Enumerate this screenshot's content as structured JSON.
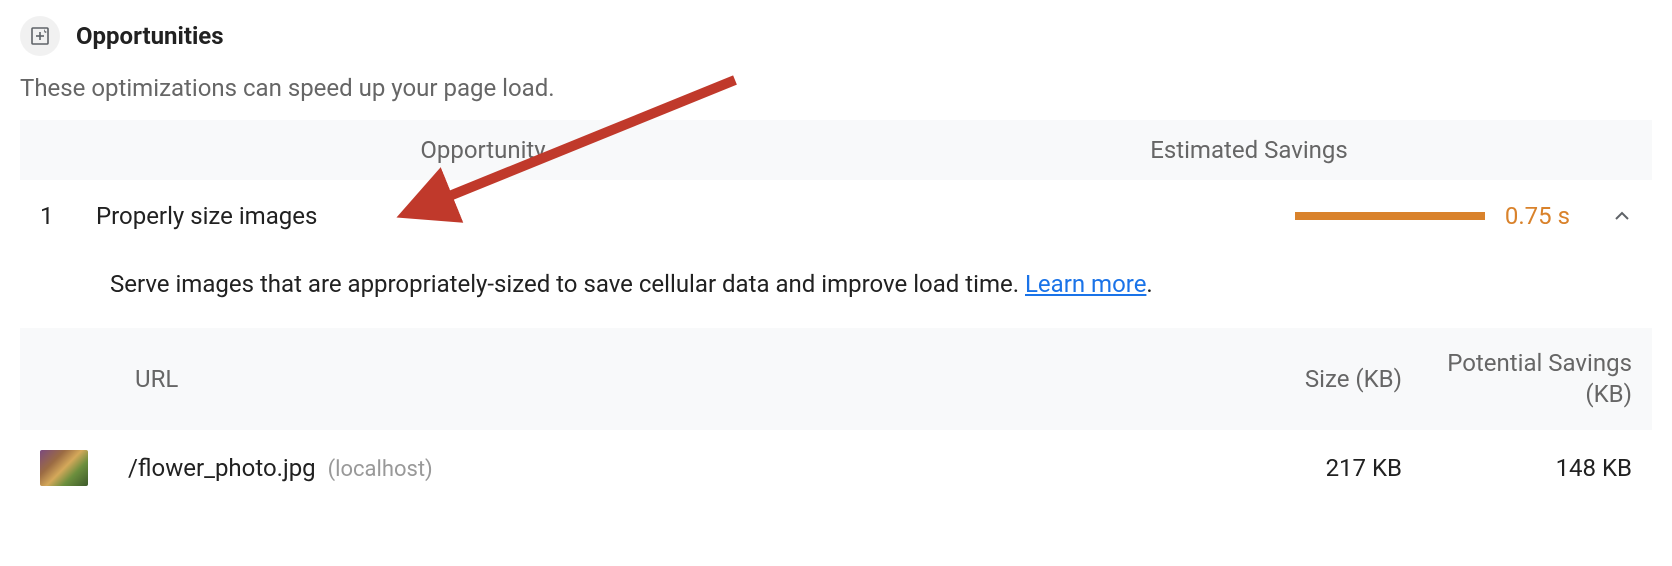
{
  "section": {
    "title": "Opportunities",
    "description": "These optimizations can speed up your page load."
  },
  "columns": {
    "opportunity": "Opportunity",
    "savings": "Estimated Savings"
  },
  "opportunity": {
    "number": "1",
    "title": "Properly size images",
    "savings_value": "0.75 s",
    "description_pre": "Serve images that are appropriately-sized to save cellular data and improve load time. ",
    "learn_more": "Learn more",
    "description_post": "."
  },
  "details_columns": {
    "url": "URL",
    "size": "Size (KB)",
    "potential": "Potential Savings (KB)"
  },
  "details_row": {
    "path": "/flower_photo.jpg",
    "host": "(localhost)",
    "size": "217 KB",
    "potential": "148 KB"
  }
}
